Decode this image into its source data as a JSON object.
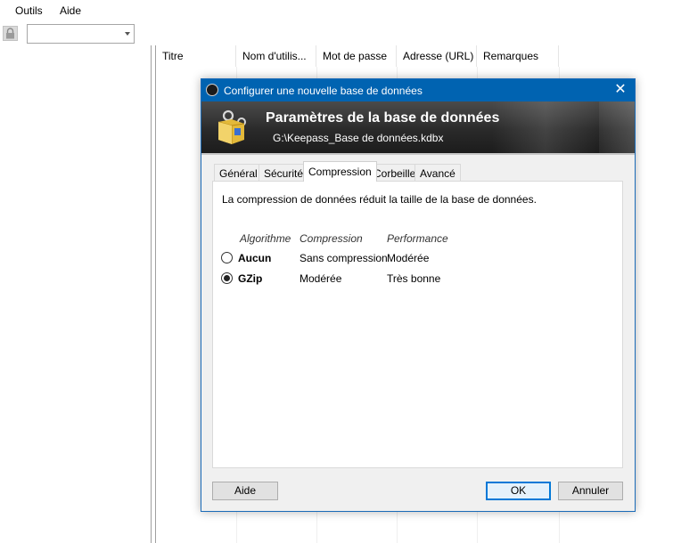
{
  "menu": {
    "items": [
      "Outils",
      "Aide"
    ]
  },
  "toolbar": {
    "combo_value": ""
  },
  "list": {
    "columns": [
      "Titre",
      "Nom d'utilis...",
      "Mot de passe",
      "Adresse (URL)",
      "Remarques"
    ]
  },
  "dialog": {
    "title": "Configurer une nouvelle base de données",
    "close_glyph": "✕",
    "banner": {
      "title": "Paramètres de la base de données",
      "subtitle": "G:\\Keepass_Base de données.kdbx"
    },
    "tabs": [
      {
        "label": "Général"
      },
      {
        "label": "Sécurité"
      },
      {
        "label": "Compression",
        "active": true
      },
      {
        "label": "Corbeille"
      },
      {
        "label": "Avancé"
      }
    ],
    "compression": {
      "description": "La compression de données réduit la taille de la base de données.",
      "headers": [
        "Algorithme",
        "Compression",
        "Performance"
      ],
      "rows": [
        {
          "algorithm": "Aucun",
          "compression": "Sans compression",
          "performance": "Modérée",
          "selected": false
        },
        {
          "algorithm": "GZip",
          "compression": "Modérée",
          "performance": "Très bonne",
          "selected": true
        }
      ]
    },
    "buttons": {
      "help": "Aide",
      "ok": "OK",
      "cancel": "Annuler"
    }
  }
}
